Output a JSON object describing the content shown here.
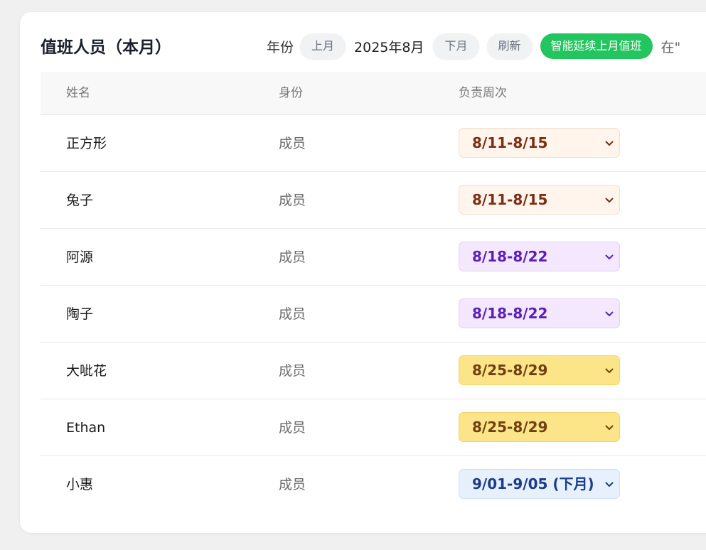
{
  "header": {
    "title": "值班人员（本月）",
    "year_label": "年份",
    "prev_label": "上月",
    "current_month": "2025年8月",
    "next_label": "下月",
    "refresh_label": "刷新",
    "continue_label": "智能延续上月值班",
    "trailing_text": "在\""
  },
  "table": {
    "columns": [
      "姓名",
      "身份",
      "负责周次"
    ],
    "rows": [
      {
        "name": "正方形",
        "role": "成员",
        "week": "8/11-8/15",
        "color": "orange"
      },
      {
        "name": "兔子",
        "role": "成员",
        "week": "8/11-8/15",
        "color": "orange"
      },
      {
        "name": "阿源",
        "role": "成员",
        "week": "8/18-8/22",
        "color": "purple"
      },
      {
        "name": "陶子",
        "role": "成员",
        "week": "8/18-8/22",
        "color": "purple"
      },
      {
        "name": "大呲花",
        "role": "成员",
        "week": "8/25-8/29",
        "color": "yellow"
      },
      {
        "name": "Ethan",
        "role": "成员",
        "week": "8/25-8/29",
        "color": "yellow"
      },
      {
        "name": "小惠",
        "role": "成员",
        "week": "9/01-9/05 (下月)",
        "color": "blue"
      }
    ]
  },
  "colors": {
    "accent_green": "#22c55e",
    "week_orange": "#fff5ec",
    "week_purple": "#f3e8ff",
    "week_yellow": "#fce588",
    "week_blue": "#e6f1fd"
  },
  "icons": {
    "select_arrow": "chevron-down-icon"
  }
}
